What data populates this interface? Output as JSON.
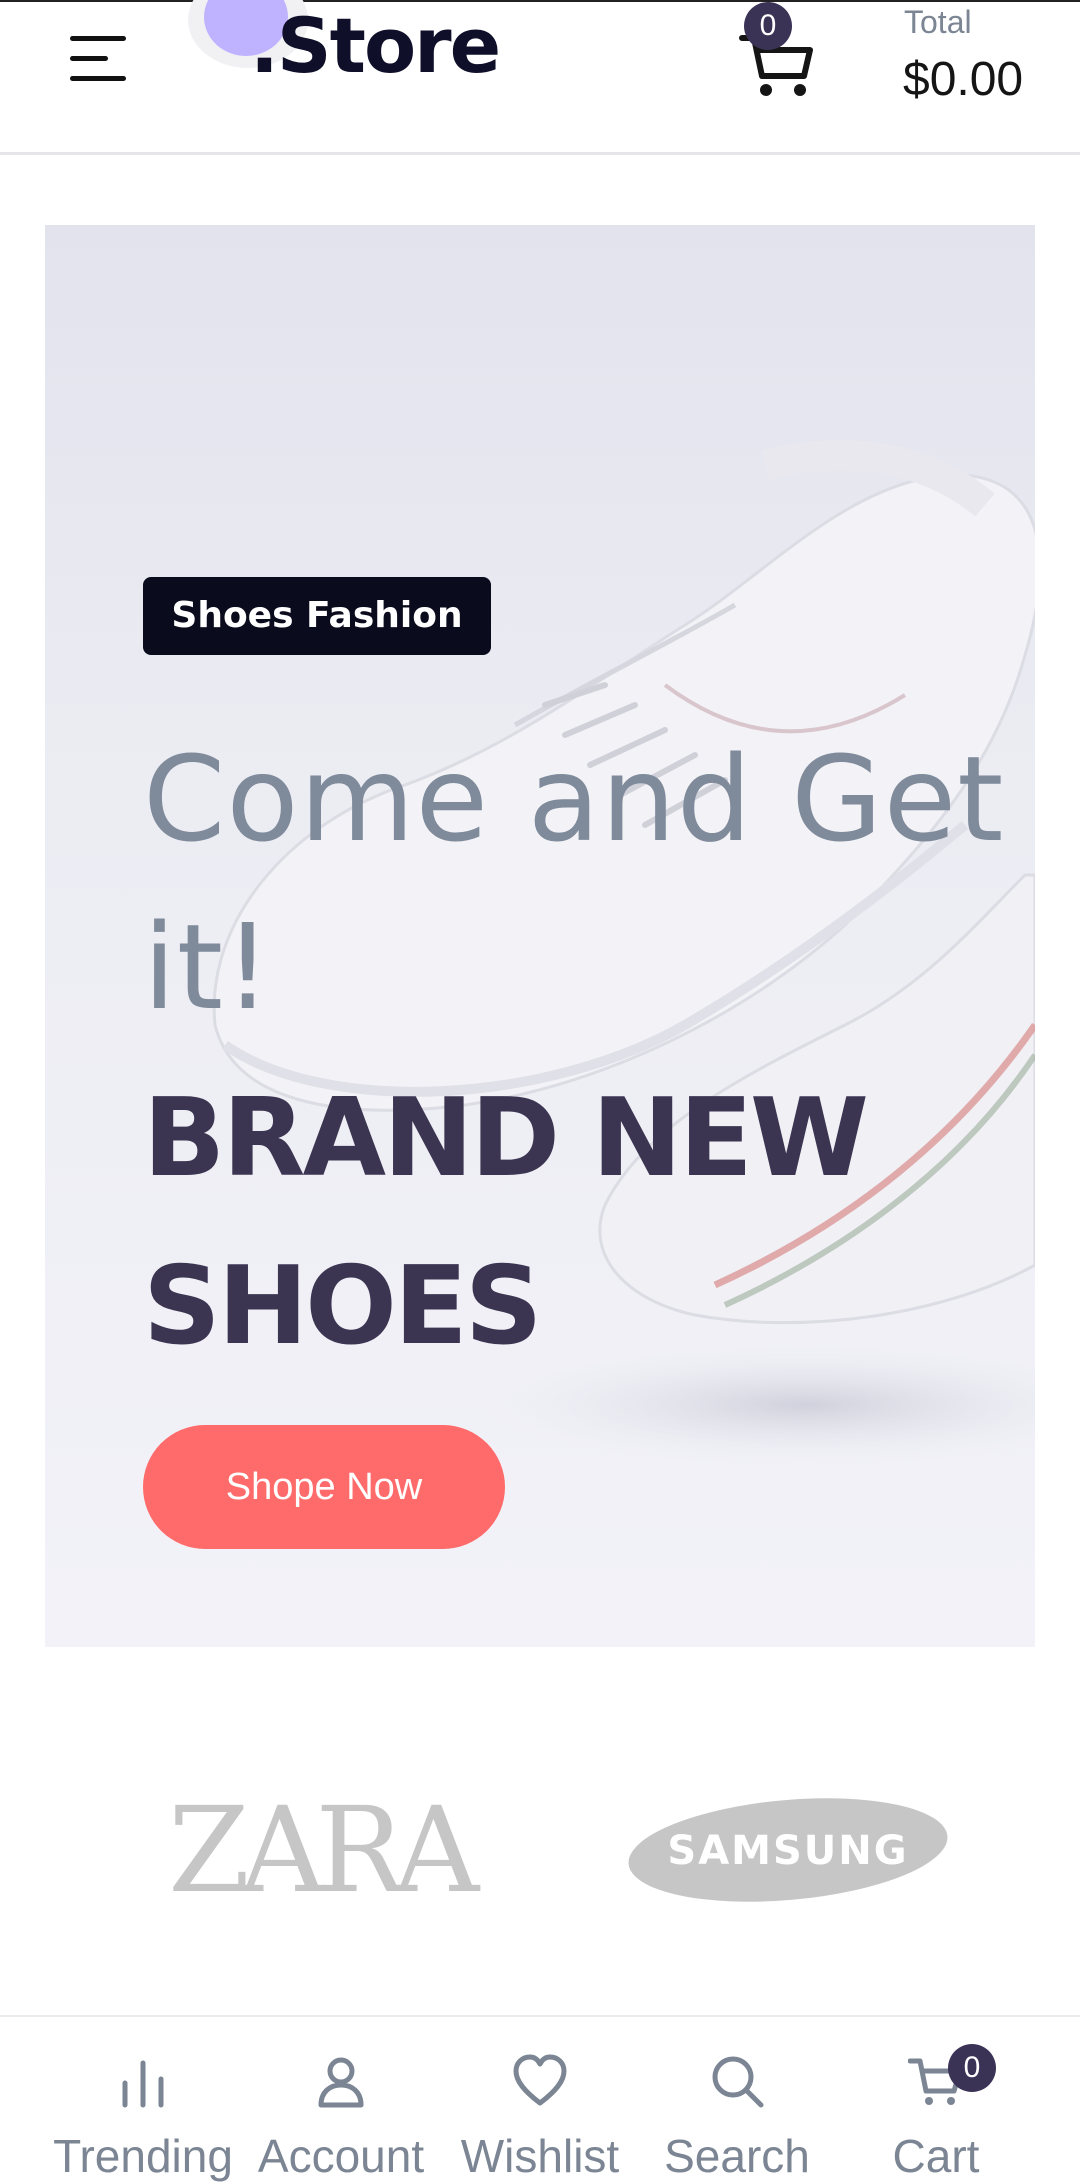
{
  "header": {
    "logo": ".Store",
    "cart_count": "0",
    "total_label": "Total",
    "total_value": "$0.00"
  },
  "hero": {
    "tag": "Shoes Fashion",
    "headline_light": "Come and Get it!",
    "headline_bold_line1": "BRAND NEW",
    "headline_bold_line2": "SHOES",
    "button": "Shope Now"
  },
  "brands": {
    "zara": "ZARA",
    "samsung": "SAMSUNG"
  },
  "bottom_nav": {
    "items": [
      {
        "label": "Trending",
        "icon": "bar-chart-icon"
      },
      {
        "label": "Account",
        "icon": "user-icon"
      },
      {
        "label": "Wishlist",
        "icon": "heart-icon"
      },
      {
        "label": "Search",
        "icon": "search-icon"
      },
      {
        "label": "Cart",
        "icon": "cart-icon"
      }
    ],
    "cart_badge": "0"
  },
  "colors": {
    "accent": "#ff6b6b",
    "dark": "#3c3552",
    "badge": "#3b3355",
    "muted": "#7b8593"
  }
}
